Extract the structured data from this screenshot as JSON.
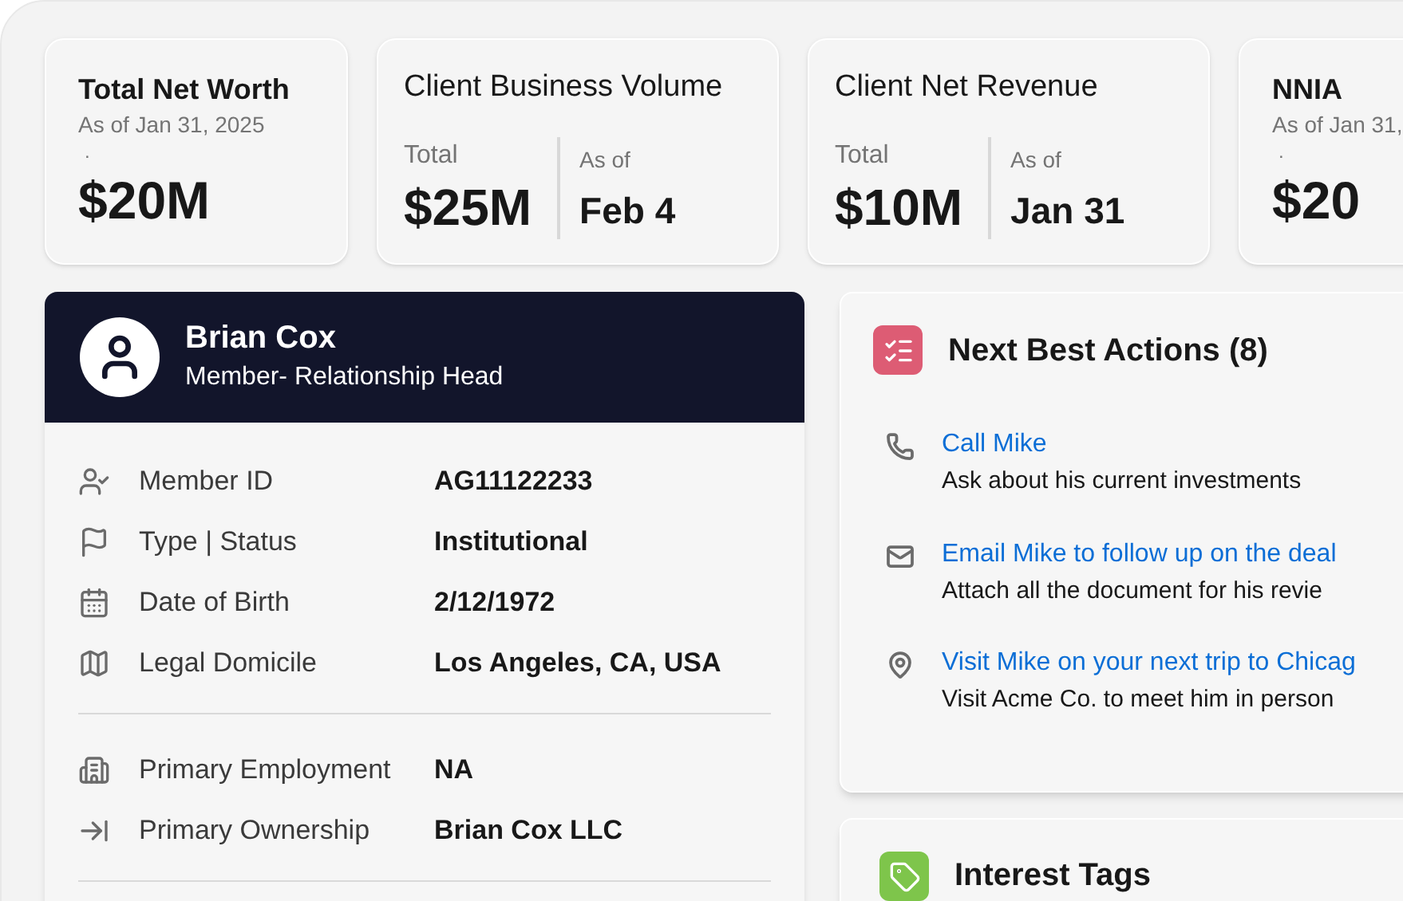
{
  "metrics": [
    {
      "kind": "single",
      "title": "Total Net Worth",
      "subtitle": "As of Jan 31, 2025",
      "marker": ".",
      "value": "$20M"
    },
    {
      "kind": "split",
      "title": "Client Business Volume",
      "left_label": "Total",
      "left_value": "$25M",
      "right_label": "As of",
      "right_value": "Feb 4"
    },
    {
      "kind": "split",
      "title": "Client Net Revenue",
      "left_label": "Total",
      "left_value": "$10M",
      "right_label": "As of",
      "right_value": "Jan 31"
    },
    {
      "kind": "single",
      "title": "NNIA",
      "subtitle": "As of Jan 31,",
      "marker": ".",
      "value": "$20"
    }
  ],
  "profile": {
    "name": "Brian Cox",
    "role": "Member- Relationship Head",
    "groups": [
      [
        {
          "kind": "member",
          "label": "Member ID",
          "value": "AG11122233"
        },
        {
          "kind": "flag",
          "label": "Type | Status",
          "value": "Institutional"
        },
        {
          "kind": "calendar",
          "label": "Date of Birth",
          "value": "2/12/1972"
        },
        {
          "kind": "map",
          "label": "Legal Domicile",
          "value": "Los Angeles, CA, USA"
        }
      ],
      [
        {
          "kind": "building",
          "label": "Primary Employment",
          "value": "NA"
        },
        {
          "kind": "ownership",
          "label": "Primary Ownership",
          "value": "Brian Cox LLC"
        }
      ]
    ]
  },
  "next_best_actions": {
    "title": "Next Best Actions (8)",
    "items": [
      {
        "kind": "phone",
        "action": "Call Mike",
        "detail": "Ask about his current investments"
      },
      {
        "kind": "mail",
        "action": "Email Mike to follow up on the deal",
        "detail": "Attach all the document for his revie"
      },
      {
        "kind": "visit",
        "action": "Visit Mike on your next trip to Chicag",
        "detail": "Visit Acme Co. to meet him in person"
      }
    ]
  },
  "interest_tags": {
    "title": "Interest Tags"
  }
}
